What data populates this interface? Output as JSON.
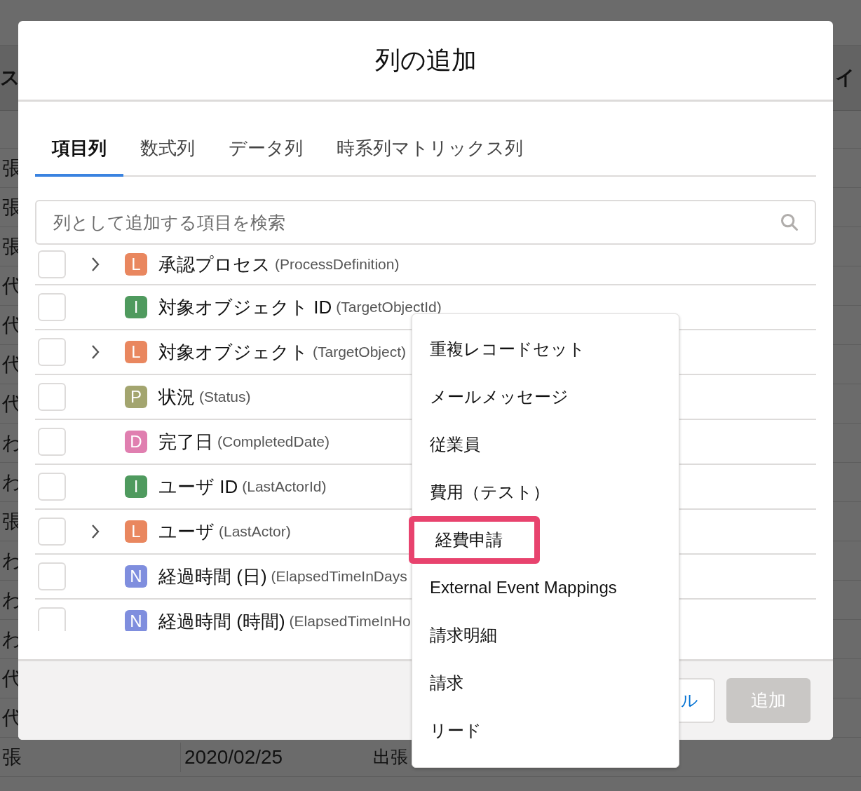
{
  "background_table": {
    "header": {
      "column_1": "ス",
      "column_last": "イ"
    },
    "rows": [
      {
        "column_1": "張"
      },
      {
        "column_1": "張"
      },
      {
        "column_1": "張"
      },
      {
        "column_1": "代"
      },
      {
        "column_1": "代"
      },
      {
        "column_1": "代"
      },
      {
        "column_1": "代"
      },
      {
        "column_1": "わ"
      },
      {
        "column_1": "わ"
      },
      {
        "column_1": "張"
      },
      {
        "column_1": "わ"
      },
      {
        "column_1": "わ"
      },
      {
        "column_1": "わ"
      },
      {
        "column_1": "代"
      },
      {
        "column_1": "代"
      },
      {
        "column_1": "張",
        "column_2": "2020/02/25",
        "column_3": "出張"
      }
    ]
  },
  "dialog": {
    "title": "列の追加",
    "tabs": [
      {
        "label": "項目列",
        "selected": true
      },
      {
        "label": "数式列",
        "selected": false
      },
      {
        "label": "データ列",
        "selected": false
      },
      {
        "label": "時系列マトリックス列",
        "selected": false
      }
    ],
    "search": {
      "placeholder": "列として追加する項目を検索"
    },
    "fields": [
      {
        "type_letter": "L",
        "color": "#e9875f",
        "label": "承認プロセス",
        "api_name": "(ProcessDefinition)",
        "checked": false,
        "expandable": true
      },
      {
        "type_letter": "I",
        "color": "#4f9a5e",
        "label": "対象オブジェクト ID",
        "api_name": "(TargetObjectId)",
        "checked": false,
        "expandable": false
      },
      {
        "type_letter": "L",
        "color": "#e9875f",
        "label": "対象オブジェクト",
        "api_name": "(TargetObject)",
        "checked": false,
        "expandable": true
      },
      {
        "type_letter": "P",
        "color": "#a3a56f",
        "label": "状況",
        "api_name": "(Status)",
        "checked": false,
        "expandable": false
      },
      {
        "type_letter": "D",
        "color": "#e07fb0",
        "label": "完了日",
        "api_name": "(CompletedDate)",
        "checked": false,
        "expandable": false
      },
      {
        "type_letter": "I",
        "color": "#4f9a5e",
        "label": "ユーザ ID",
        "api_name": "(LastActorId)",
        "checked": false,
        "expandable": false
      },
      {
        "type_letter": "L",
        "color": "#e9875f",
        "label": "ユーザ",
        "api_name": "(LastActor)",
        "checked": false,
        "expandable": true
      },
      {
        "type_letter": "N",
        "color": "#7f8ede",
        "label": "経過時間 (日)",
        "api_name": "(ElapsedTimeInDays",
        "checked": false,
        "expandable": false
      },
      {
        "type_letter": "N",
        "color": "#7f8ede",
        "label": "経過時間 (時間)",
        "api_name": "(ElapsedTimeInHo",
        "checked": false,
        "expandable": false
      }
    ],
    "buttons": [
      {
        "label": "ル",
        "disabled": false
      },
      {
        "label": "追加",
        "disabled": true
      }
    ]
  },
  "dropdown": {
    "items": [
      {
        "label": "重複レコードセット",
        "highlighted": false
      },
      {
        "label": "メールメッセージ",
        "highlighted": false
      },
      {
        "label": "従業員",
        "highlighted": false
      },
      {
        "label": "費用（テスト）",
        "highlighted": false
      },
      {
        "label": "経費申請",
        "highlighted": true
      },
      {
        "label": "External Event Mappings",
        "highlighted": false
      },
      {
        "label": "請求明細",
        "highlighted": false
      },
      {
        "label": "請求",
        "highlighted": false
      },
      {
        "label": "リード",
        "highlighted": false
      }
    ]
  }
}
